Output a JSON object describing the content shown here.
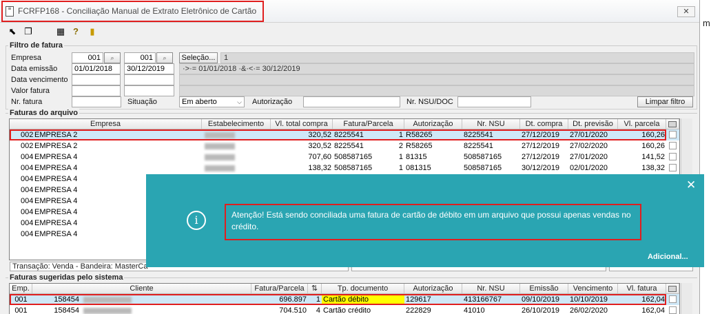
{
  "window": {
    "title": "FCRFP168 - Conciliação Manual de Extrato Eletrônico de Cartão",
    "close_label": "✕"
  },
  "toolbar": {
    "icons": [
      "back-arrow-icon",
      "windows-icon",
      "calculator-icon",
      "help-icon",
      "exit-door-icon"
    ]
  },
  "filter": {
    "title": "Filtro de fatura",
    "empresa_label": "Empresa",
    "empresa_from": "001",
    "empresa_to": "001",
    "selecao_label": "Seleção...",
    "selecao_value": "1",
    "data_emissao_label": "Data emissão",
    "data_emissao_from": "01/01/2018",
    "data_emissao_to": "30/12/2019",
    "data_emissao_expr": "·>·= 01/01/2018 ·&·<·= 30/12/2019",
    "data_vencimento_label": "Data vencimento",
    "valor_fatura_label": "Valor fatura",
    "nr_fatura_label": "Nr. fatura",
    "situacao_label": "Situação",
    "situacao_value": "Em aberto",
    "autorizacao_label": "Autorização",
    "nsu_label": "Nr. NSU/DOC",
    "limpar_label": "Limpar filtro"
  },
  "faturas_arquivo": {
    "title": "Faturas do arquivo",
    "columns": {
      "empresa": "Empresa",
      "estabelecimento": "Estabelecimento",
      "vl_total": "Vl. total compra",
      "fatura": "Fatura/Parcela",
      "autorizacao": "Autorização",
      "nsu": "Nr. NSU",
      "dt_compra": "Dt. compra",
      "dt_previsao": "Dt. previsão",
      "vl_parcela": "Vl. parcela"
    },
    "rows": [
      {
        "empresa_cod": "002",
        "empresa_nome": "EMPRESA 2",
        "estabelecimento_redacted": true,
        "vl_total": "320,52",
        "fatura": "8225541",
        "parcela": "1",
        "autorizacao": "R58265",
        "nsu": "8225541",
        "dt_compra": "27/12/2019",
        "dt_previsao": "27/01/2020",
        "vl_parcela": "160,26",
        "selected": true
      },
      {
        "empresa_cod": "002",
        "empresa_nome": "EMPRESA 2",
        "estabelecimento_redacted": true,
        "vl_total": "320,52",
        "fatura": "8225541",
        "parcela": "2",
        "autorizacao": "R58265",
        "nsu": "8225541",
        "dt_compra": "27/12/2019",
        "dt_previsao": "27/02/2020",
        "vl_parcela": "160,26"
      },
      {
        "empresa_cod": "004",
        "empresa_nome": "EMPRESA 4",
        "estabelecimento_redacted": true,
        "vl_total": "707,60",
        "fatura": "508587165",
        "parcela": "1",
        "autorizacao": "81315",
        "nsu": "508587165",
        "dt_compra": "27/12/2019",
        "dt_previsao": "27/01/2020",
        "vl_parcela": "141,52"
      },
      {
        "empresa_cod": "004",
        "empresa_nome": "EMPRESA 4",
        "estabelecimento_redacted": true,
        "vl_total": "138,32",
        "fatura": "508587165",
        "parcela": "1",
        "autorizacao": "081315",
        "nsu": "508587165",
        "dt_compra": "30/12/2019",
        "dt_previsao": "02/01/2020",
        "vl_parcela": "138,32"
      },
      {
        "empresa_cod": "004",
        "empresa_nome": "EMPRESA 4"
      },
      {
        "empresa_cod": "004",
        "empresa_nome": "EMPRESA 4"
      },
      {
        "empresa_cod": "004",
        "empresa_nome": "EMPRESA 4"
      },
      {
        "empresa_cod": "004",
        "empresa_nome": "EMPRESA 4"
      },
      {
        "empresa_cod": "004",
        "empresa_nome": "EMPRESA 4"
      },
      {
        "empresa_cod": "004",
        "empresa_nome": "EMPRESA 4"
      }
    ],
    "status": "Transação: Venda - Bandeira: MasterCa"
  },
  "toast": {
    "message": "Atenção! Está sendo conciliada uma fatura de cartão de débito em um arquivo que possui apenas vendas no crédito.",
    "more_label": "Adicional...",
    "info_glyph": "i",
    "close_glyph": "✕"
  },
  "faturas_sugeridas": {
    "title": "Faturas sugeridas pelo sistema",
    "columns": {
      "emp": "Emp.",
      "cliente": "Cliente",
      "fatura": "Fatura/Parcela",
      "parcela": "",
      "tp_documento": "Tp. documento",
      "autorizacao": "Autorização",
      "nsu": "Nr. NSU",
      "emissao": "Emissão",
      "vencimento": "Vencimento",
      "vl_fatura": "Vl. fatura"
    },
    "rows": [
      {
        "emp": "001",
        "cliente_cod": "158454",
        "cliente_redacted": true,
        "fatura": "696.897",
        "parcela": "1",
        "tp_documento": "Cartão débito",
        "tp_highlight": true,
        "autorizacao": "129617",
        "nsu": "413166767",
        "emissao": "09/10/2019",
        "vencimento": "10/10/2019",
        "vl_fatura": "162,04",
        "selected": true
      },
      {
        "emp": "001",
        "cliente_cod": "158454",
        "cliente_redacted": true,
        "fatura": "704.510",
        "parcela": "4",
        "tp_documento": "Cartão crédito",
        "autorizacao": "222829",
        "nsu": "41010",
        "emissao": "26/10/2019",
        "vencimento": "26/02/2020",
        "vl_fatura": "162,04"
      }
    ]
  },
  "side": {
    "letter": "m"
  },
  "colors": {
    "toast_bg": "#2aa5b2",
    "highlight_border": "#e01e1e",
    "selection_bg": "#cfe8f7",
    "warning_cell_bg": "#ffff00"
  }
}
